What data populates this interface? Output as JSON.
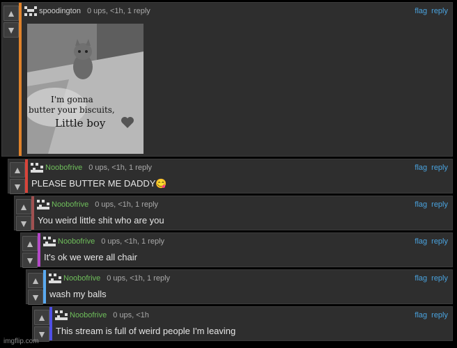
{
  "colors": {
    "thread_bars": [
      "#e0822a",
      "#d9443a",
      "#a05050",
      "#b448c8",
      "#5aaaf0",
      "#5050e6"
    ],
    "username_color": "#6fbf5b",
    "op_username_color": "#cfcfcf",
    "link_color": "#4aa3df"
  },
  "icons": {
    "upvote": "arrow-up-icon",
    "downvote": "arrow-down-icon",
    "avatar": "pixel-avatar-icon",
    "heart": "grey-heart-icon"
  },
  "actions": {
    "flag": "flag",
    "reply": "reply"
  },
  "comments": [
    {
      "user": "spoodington",
      "meta": "0 ups, <1h, 1 reply",
      "image_caption": [
        "I'm gonna",
        "butter your biscuits,",
        "Little boy"
      ]
    },
    {
      "user": "Noobofrive",
      "meta": "0 ups, <1h, 1 reply",
      "text": "PLEASE BUTTER ME DADDY😋"
    },
    {
      "user": "Noobofrive",
      "meta": "0 ups, <1h, 1 reply",
      "text": "You weird little shit who are you"
    },
    {
      "user": "Noobofrive",
      "meta": "0 ups, <1h, 1 reply",
      "text": "It's ok we were all chair"
    },
    {
      "user": "Noobofrive",
      "meta": "0 ups, <1h, 1 reply",
      "text": "wash my balls"
    },
    {
      "user": "Noobofrive",
      "meta": "0 ups, <1h",
      "text": "This stream is full of weird people I'm leaving"
    }
  ],
  "watermark": "imgflip.com"
}
